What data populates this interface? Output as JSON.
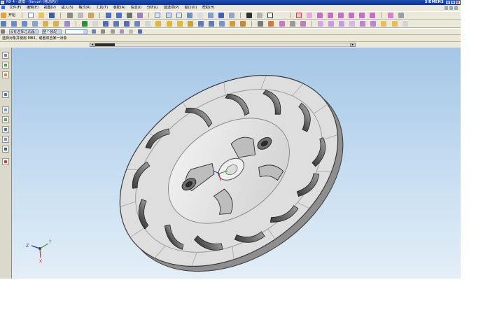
{
  "app": {
    "title": "NX 4 - 建模 - [fan.prt (修改的)]",
    "brand": "SIEMENS"
  },
  "menu": {
    "items": [
      "文件(F)",
      "编辑(E)",
      "视图(V)",
      "插入(S)",
      "格式(R)",
      "工具(T)",
      "装配(A)",
      "信息(I)",
      "分析(L)",
      "首选项(P)",
      "窗口(O)",
      "帮助(H)"
    ]
  },
  "toolbar": {
    "start_label": "开始",
    "selection_filter": "没有选择过滤器",
    "assembly_scope": "整个装配"
  },
  "cue_line": "选择对象并使用 MB3，或者双击某一对象",
  "viewport": {
    "model": "fan-impeller",
    "background_top": "#a4c6e6",
    "background_bottom": "#e3eef7",
    "triad": {
      "x": "X",
      "y": "Y",
      "z": "Z"
    }
  }
}
